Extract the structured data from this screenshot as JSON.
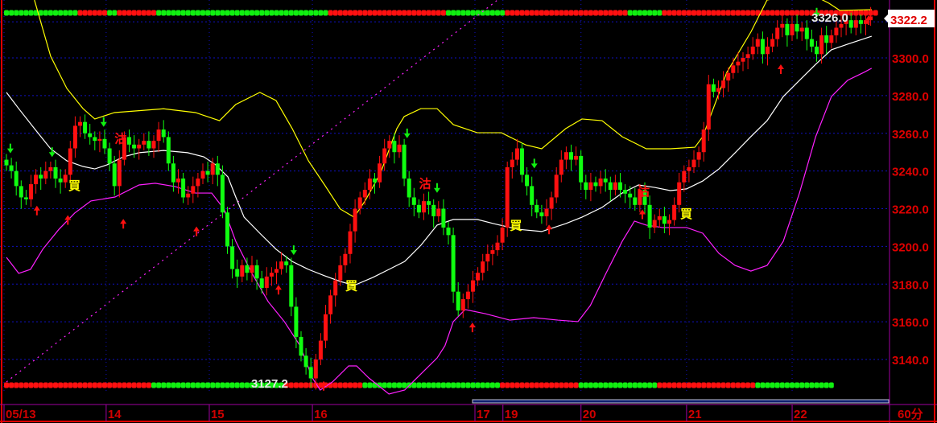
{
  "chart_data": {
    "type": "candlestick",
    "interval_label": "60分",
    "current_price": "3322.2",
    "high_label": "3326.0",
    "low_label": "3127.2",
    "ylim": [
      3120,
      3332
    ],
    "y_ticks": [
      "3140.0",
      "3160.0",
      "3180.0",
      "3200.0",
      "3220.0",
      "3240.0",
      "3260.0",
      "3280.0",
      "3300.0"
    ],
    "y_tick_values": [
      3140,
      3160,
      3180,
      3200,
      3220,
      3240,
      3260,
      3280,
      3300
    ],
    "x_ticks": [
      {
        "label": "05/13",
        "bar": 0
      },
      {
        "label": "14",
        "bar": 20.8
      },
      {
        "label": "15",
        "bar": 41.8
      },
      {
        "label": "16",
        "bar": 62.8
      },
      {
        "label": "17",
        "bar": 95.9
      },
      {
        "label": "19",
        "bar": 101.6
      },
      {
        "label": "20",
        "bar": 117.5
      },
      {
        "label": "21",
        "bar": 139
      },
      {
        "label": "22",
        "bar": 160.5
      }
    ],
    "closes": [
      3243,
      3240,
      3232,
      3226,
      3225,
      3233,
      3238,
      3236,
      3240,
      3242,
      3236,
      3234,
      3238,
      3252,
      3264,
      3266,
      3260,
      3258,
      3256,
      3257,
      3252,
      3244,
      3232,
      3246,
      3258,
      3254,
      3252,
      3254,
      3256,
      3252,
      3256,
      3262,
      3258,
      3244,
      3234,
      3236,
      3226,
      3228,
      3232,
      3236,
      3240,
      3238,
      3244,
      3238,
      3218,
      3200,
      3188,
      3184,
      3190,
      3186,
      3190,
      3183,
      3178,
      3184,
      3186,
      3188,
      3192,
      3190,
      3168,
      3152,
      3142,
      3136,
      3130,
      3140,
      3150,
      3164,
      3174,
      3182,
      3190,
      3196,
      3208,
      3220,
      3226,
      3230,
      3236,
      3234,
      3244,
      3252,
      3256,
      3250,
      3254,
      3236,
      3226,
      3222,
      3218,
      3224,
      3222,
      3216,
      3220,
      3210,
      3206,
      3176,
      3166,
      3172,
      3176,
      3182,
      3186,
      3192,
      3196,
      3198,
      3202,
      3210,
      3242,
      3246,
      3252,
      3238,
      3232,
      3222,
      3218,
      3216,
      3220,
      3226,
      3238,
      3246,
      3250,
      3246,
      3248,
      3234,
      3230,
      3234,
      3232,
      3236,
      3234,
      3230,
      3234,
      3230,
      3228,
      3226,
      3222,
      3230,
      3222,
      3210,
      3214,
      3216,
      3212,
      3214,
      3222,
      3234,
      3240,
      3242,
      3246,
      3250,
      3262,
      3286,
      3282,
      3284,
      3288,
      3292,
      3296,
      3298,
      3300,
      3302,
      3306,
      3310,
      3302,
      3306,
      3310,
      3316,
      3318,
      3312,
      3318,
      3314,
      3316,
      3310,
      3306,
      3302,
      3312,
      3308,
      3312,
      3316,
      3318,
      3320,
      3316,
      3320,
      3318,
      3320,
      3322
    ],
    "first_open": 3246,
    "bands": {
      "upper": [
        [
          5.7,
          3330.7
        ],
        [
          9,
          3300.9
        ],
        [
          12.3,
          3283.8
        ],
        [
          15.6,
          3273.1
        ],
        [
          18,
          3267.6
        ],
        [
          22,
          3271
        ],
        [
          32,
          3273
        ],
        [
          38.5,
          3271
        ],
        [
          43.4,
          3266.7
        ],
        [
          46.7,
          3275.3
        ],
        [
          51.6,
          3281.7
        ],
        [
          54.9,
          3277.4
        ],
        [
          58.2,
          3262.5
        ],
        [
          61.5,
          3245.4
        ],
        [
          64.8,
          3232.6
        ],
        [
          68,
          3219.8
        ],
        [
          70.8,
          3215.5
        ],
        [
          73,
          3224
        ],
        [
          76.2,
          3239
        ],
        [
          79.5,
          3262.5
        ],
        [
          81,
          3268.9
        ],
        [
          84.4,
          3273.1
        ],
        [
          87.7,
          3273.1
        ],
        [
          91,
          3264.6
        ],
        [
          95.9,
          3260.3
        ],
        [
          100.8,
          3260.3
        ],
        [
          105.7,
          3253.9
        ],
        [
          109,
          3251.8
        ],
        [
          113.9,
          3262.5
        ],
        [
          117.2,
          3267.6
        ],
        [
          121.3,
          3266.7
        ],
        [
          125.4,
          3258.2
        ],
        [
          130.3,
          3251.8
        ],
        [
          135.2,
          3251.8
        ],
        [
          140.2,
          3252.6
        ],
        [
          141.8,
          3258.2
        ],
        [
          146.7,
          3292.3
        ],
        [
          151.6,
          3313.7
        ],
        [
          154.9,
          3330.7
        ],
        [
          163,
          3335
        ],
        [
          167.5,
          3329
        ],
        [
          169.7,
          3325.2
        ],
        [
          176.2,
          3325.6
        ]
      ],
      "middle": [
        [
          0,
          3281.7
        ],
        [
          2.5,
          3273.1
        ],
        [
          5.7,
          3262.5
        ],
        [
          9,
          3251.8
        ],
        [
          12.3,
          3245.4
        ],
        [
          15.6,
          3242.4
        ],
        [
          18,
          3241.1
        ],
        [
          20.5,
          3243.3
        ],
        [
          23.8,
          3247.5
        ],
        [
          27,
          3249.7
        ],
        [
          32,
          3250.9
        ],
        [
          36.9,
          3249.7
        ],
        [
          40.2,
          3247.5
        ],
        [
          42.6,
          3243.3
        ],
        [
          45.1,
          3236.9
        ],
        [
          46.7,
          3226.2
        ],
        [
          48.4,
          3215.5
        ],
        [
          51.6,
          3207
        ],
        [
          54.9,
          3198.5
        ],
        [
          58.2,
          3192
        ],
        [
          61.5,
          3187.8
        ],
        [
          64.8,
          3184.4
        ],
        [
          68,
          3181.4
        ],
        [
          70.8,
          3179.3
        ],
        [
          74.6,
          3183.5
        ],
        [
          77.9,
          3187.8
        ],
        [
          81.1,
          3192
        ],
        [
          84.4,
          3200.6
        ],
        [
          87.7,
          3211.3
        ],
        [
          91,
          3214.3
        ],
        [
          95.9,
          3214.3
        ],
        [
          99.2,
          3212.1
        ],
        [
          104.1,
          3209.1
        ],
        [
          109,
          3207.9
        ],
        [
          113.9,
          3212.1
        ],
        [
          117.2,
          3215.5
        ],
        [
          121.3,
          3220.7
        ],
        [
          125.4,
          3228.3
        ],
        [
          128.7,
          3232.6
        ],
        [
          132,
          3231.3
        ],
        [
          135.2,
          3229.6
        ],
        [
          138.5,
          3230.5
        ],
        [
          141.8,
          3234.7
        ],
        [
          145.1,
          3241.1
        ],
        [
          148.4,
          3249.7
        ],
        [
          151.6,
          3258.2
        ],
        [
          154.9,
          3266.7
        ],
        [
          158.2,
          3279.5
        ],
        [
          161.5,
          3288.1
        ],
        [
          164.8,
          3296.6
        ],
        [
          168,
          3304.3
        ],
        [
          171.3,
          3307.3
        ],
        [
          176.2,
          3311.5
        ]
      ],
      "lower": [
        [
          0,
          3194.2
        ],
        [
          2.5,
          3185.7
        ],
        [
          4.9,
          3187.8
        ],
        [
          7.4,
          3198.5
        ],
        [
          10.7,
          3209.1
        ],
        [
          13.9,
          3217.7
        ],
        [
          17.2,
          3224.1
        ],
        [
          22.1,
          3226.2
        ],
        [
          27,
          3232.6
        ],
        [
          30.3,
          3233.5
        ],
        [
          34.4,
          3231.7
        ],
        [
          38.5,
          3228.3
        ],
        [
          41.8,
          3228.3
        ],
        [
          44.3,
          3219.8
        ],
        [
          46.7,
          3202.7
        ],
        [
          50,
          3185.7
        ],
        [
          53.3,
          3170.7
        ],
        [
          56.6,
          3160.1
        ],
        [
          59.8,
          3147.3
        ],
        [
          62.3,
          3130.2
        ],
        [
          63.9,
          3123.8
        ],
        [
          66.4,
          3128.1
        ],
        [
          69.7,
          3136.6
        ],
        [
          71.3,
          3136.6
        ],
        [
          73.8,
          3130.2
        ],
        [
          77.9,
          3121.7
        ],
        [
          81.1,
          3123.8
        ],
        [
          84.4,
          3132.3
        ],
        [
          87.7,
          3140.8
        ],
        [
          89.3,
          3147.3
        ],
        [
          91,
          3160.1
        ],
        [
          93.4,
          3166.5
        ],
        [
          97.5,
          3164.3
        ],
        [
          102.5,
          3160.9
        ],
        [
          107.4,
          3162.2
        ],
        [
          112.3,
          3160.9
        ],
        [
          116.4,
          3160.1
        ],
        [
          118.9,
          3168.6
        ],
        [
          122.1,
          3185.7
        ],
        [
          125.4,
          3202.7
        ],
        [
          127.9,
          3213.4
        ],
        [
          130.3,
          3211.3
        ],
        [
          133.6,
          3210
        ],
        [
          138.5,
          3210
        ],
        [
          141.8,
          3207
        ],
        [
          145.1,
          3196.3
        ],
        [
          148.4,
          3189.9
        ],
        [
          151.6,
          3186.9
        ],
        [
          154.9,
          3189.9
        ],
        [
          158.2,
          3202.7
        ],
        [
          161.5,
          3228.3
        ],
        [
          164.8,
          3258.2
        ],
        [
          168,
          3279.5
        ],
        [
          171.3,
          3288.1
        ],
        [
          174.6,
          3292.3
        ],
        [
          176.2,
          3294.5
        ]
      ],
      "trendline": [
        [
          0,
          3128.1
        ],
        [
          100,
          3330.7
        ]
      ]
    },
    "signal_rows": {
      "top": [
        [
          0,
          15,
          "g"
        ],
        [
          15,
          21,
          "r"
        ],
        [
          21,
          23,
          "g"
        ],
        [
          23,
          31,
          "r"
        ],
        [
          31,
          66,
          "g"
        ],
        [
          66,
          90,
          "r"
        ],
        [
          90,
          102,
          "g"
        ],
        [
          102,
          127,
          "r"
        ],
        [
          127,
          134,
          "g"
        ],
        [
          134,
          178,
          "r"
        ]
      ],
      "bottom": [
        [
          0,
          30,
          "r"
        ],
        [
          30,
          57,
          "g"
        ],
        [
          57,
          73,
          "r"
        ],
        [
          73,
          101,
          "g"
        ],
        [
          101,
          117,
          "r"
        ],
        [
          117,
          133,
          "g"
        ],
        [
          133,
          153,
          "r"
        ],
        [
          153,
          169,
          "g"
        ]
      ]
    },
    "markers": {
      "buy_text": "買",
      "sell_text": "沽",
      "buy": [
        [
          13.6,
          3233
        ],
        [
          70,
          3180
        ],
        [
          103.5,
          3212
        ],
        [
          138.2,
          3218
        ]
      ],
      "sell": [
        [
          23,
          3258
        ],
        [
          85,
          3234
        ],
        [
          129.5,
          3230
        ]
      ],
      "down_arrows": [
        [
          0.8,
          3246
        ],
        [
          9.3,
          3244
        ],
        [
          19.8,
          3260
        ],
        [
          58.5,
          3192
        ],
        [
          81.6,
          3254
        ],
        [
          87.7,
          3225
        ],
        [
          107.5,
          3238
        ],
        [
          165,
          3318
        ]
      ],
      "up_arrows": [
        [
          6.2,
          3225
        ],
        [
          23.8,
          3218
        ],
        [
          12.5,
          3220
        ],
        [
          38.7,
          3214
        ],
        [
          55.4,
          3183
        ],
        [
          64.6,
          3132
        ],
        [
          94.9,
          3163
        ],
        [
          110.5,
          3215
        ],
        [
          129.5,
          3223
        ],
        [
          157.7,
          3300
        ],
        [
          175.6,
          3326
        ]
      ]
    },
    "colors": {
      "up": "#ff1010",
      "down": "#10ff10",
      "upper": "#ffff00",
      "middle": "#ffffff",
      "lower": "#ff20ff",
      "grid": "#1010c0",
      "axis": "#a000a0"
    }
  }
}
